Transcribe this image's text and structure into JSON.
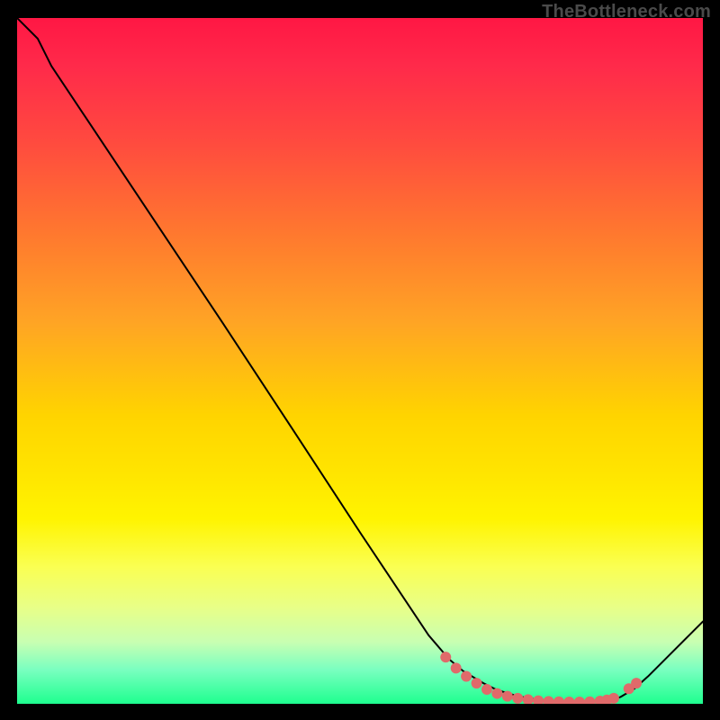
{
  "watermark": "TheBottleneck.com",
  "colors": {
    "curve": "#000000",
    "dot": "#e06a6a",
    "background": "#000000"
  },
  "chart_data": {
    "type": "line",
    "title": "",
    "xlabel": "",
    "ylabel": "",
    "xlim": [
      0,
      100
    ],
    "ylim": [
      0,
      100
    ],
    "grid": false,
    "legend": false,
    "note": "No axis ticks or labels are rendered; values are estimated from pixel positions within the 100×100 plot coordinate space (0,0 bottom-left).",
    "series": [
      {
        "name": "curve",
        "x": [
          0,
          3,
          5,
          10,
          20,
          30,
          40,
          50,
          60,
          63,
          65,
          68,
          70,
          73,
          76,
          79,
          82,
          85,
          87,
          88,
          90,
          92,
          95,
          98,
          100
        ],
        "y": [
          100,
          97,
          93,
          85.5,
          70.5,
          55.5,
          40.3,
          25,
          10,
          6.5,
          4.8,
          3,
          2,
          1.1,
          0.6,
          0.3,
          0.25,
          0.3,
          0.6,
          1,
          2.2,
          4,
          7,
          10,
          12
        ]
      }
    ],
    "points": [
      {
        "x": 62.5,
        "y": 6.8
      },
      {
        "x": 64.0,
        "y": 5.2
      },
      {
        "x": 65.5,
        "y": 4.0
      },
      {
        "x": 67.0,
        "y": 3.0
      },
      {
        "x": 68.5,
        "y": 2.1
      },
      {
        "x": 70.0,
        "y": 1.5
      },
      {
        "x": 71.5,
        "y": 1.1
      },
      {
        "x": 73.0,
        "y": 0.8
      },
      {
        "x": 74.5,
        "y": 0.6
      },
      {
        "x": 76.0,
        "y": 0.45
      },
      {
        "x": 77.5,
        "y": 0.35
      },
      {
        "x": 79.0,
        "y": 0.3
      },
      {
        "x": 80.5,
        "y": 0.27
      },
      {
        "x": 82.0,
        "y": 0.27
      },
      {
        "x": 83.5,
        "y": 0.3
      },
      {
        "x": 85.0,
        "y": 0.4
      },
      {
        "x": 86.0,
        "y": 0.55
      },
      {
        "x": 87.0,
        "y": 0.8
      },
      {
        "x": 89.2,
        "y": 2.2
      },
      {
        "x": 90.3,
        "y": 3.0
      }
    ],
    "dot_radius": 6
  }
}
